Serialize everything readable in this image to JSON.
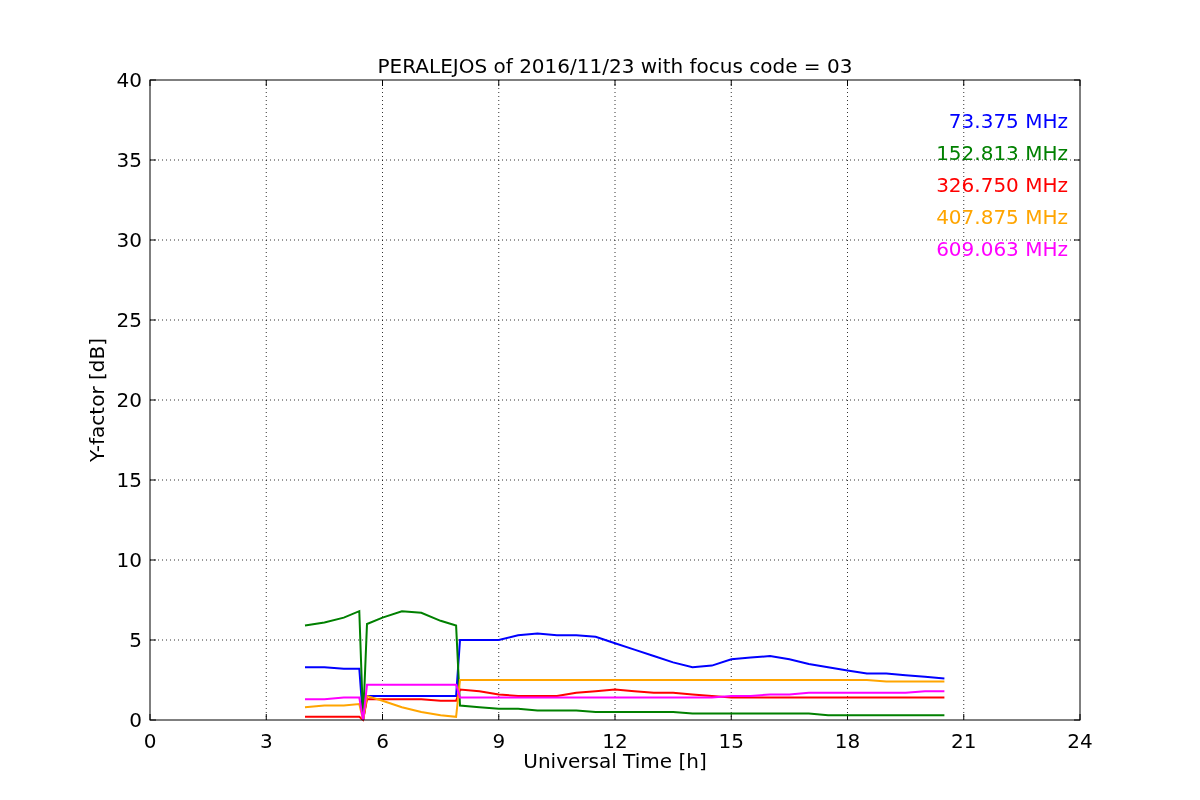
{
  "chart_data": {
    "type": "line",
    "title": "PERALEJOS of 2016/11/23 with focus code = 03",
    "xlabel": "Universal Time [h]",
    "ylabel": "Y-factor [dB]",
    "x": [
      4,
      4.5,
      5,
      5.4,
      5.5,
      5.6,
      6,
      6.5,
      7,
      7.5,
      7.9,
      8,
      8.5,
      9,
      9.5,
      10,
      10.5,
      11,
      11.5,
      12,
      12.5,
      13,
      13.5,
      14,
      14.5,
      15,
      15.5,
      16,
      16.5,
      17,
      17.5,
      18,
      18.5,
      19,
      19.5,
      20,
      20.5
    ],
    "series": [
      {
        "name": "73.375 MHz",
        "color": "#0000ff",
        "values": [
          3.3,
          3.3,
          3.2,
          3.2,
          0,
          1.5,
          1.5,
          1.5,
          1.5,
          1.5,
          1.5,
          5.0,
          5.0,
          5.0,
          5.3,
          5.4,
          5.3,
          5.3,
          5.2,
          4.8,
          4.4,
          4.0,
          3.6,
          3.3,
          3.4,
          3.8,
          3.9,
          4.0,
          3.8,
          3.5,
          3.3,
          3.1,
          2.9,
          2.9,
          2.8,
          2.7,
          2.6
        ]
      },
      {
        "name": "152.813 MHz",
        "color": "#008000",
        "values": [
          5.9,
          6.1,
          6.4,
          6.8,
          0,
          6.0,
          6.4,
          6.8,
          6.7,
          6.2,
          5.9,
          0.9,
          0.8,
          0.7,
          0.7,
          0.6,
          0.6,
          0.6,
          0.5,
          0.5,
          0.5,
          0.5,
          0.5,
          0.4,
          0.4,
          0.4,
          0.4,
          0.4,
          0.4,
          0.4,
          0.3,
          0.3,
          0.3,
          0.3,
          0.3,
          0.3,
          0.3
        ]
      },
      {
        "name": "326.750 MHz",
        "color": "#ff0000",
        "values": [
          0.2,
          0.2,
          0.2,
          0.2,
          0,
          1.3,
          1.3,
          1.3,
          1.3,
          1.2,
          1.2,
          1.9,
          1.8,
          1.6,
          1.5,
          1.5,
          1.5,
          1.7,
          1.8,
          1.9,
          1.8,
          1.7,
          1.7,
          1.6,
          1.5,
          1.4,
          1.4,
          1.4,
          1.4,
          1.4,
          1.4,
          1.4,
          1.4,
          1.4,
          1.4,
          1.4,
          1.4
        ]
      },
      {
        "name": "407.875 MHz",
        "color": "#ffa500",
        "values": [
          0.8,
          0.9,
          0.9,
          1.0,
          0,
          1.5,
          1.2,
          0.8,
          0.5,
          0.3,
          0.2,
          2.5,
          2.5,
          2.5,
          2.5,
          2.5,
          2.5,
          2.5,
          2.5,
          2.5,
          2.5,
          2.5,
          2.5,
          2.5,
          2.5,
          2.5,
          2.5,
          2.5,
          2.5,
          2.5,
          2.5,
          2.5,
          2.5,
          2.4,
          2.4,
          2.4,
          2.4
        ]
      },
      {
        "name": "609.063 MHz",
        "color": "#ff00ff",
        "values": [
          1.3,
          1.3,
          1.4,
          1.4,
          0,
          2.2,
          2.2,
          2.2,
          2.2,
          2.2,
          2.2,
          1.4,
          1.4,
          1.4,
          1.4,
          1.4,
          1.4,
          1.4,
          1.4,
          1.4,
          1.4,
          1.4,
          1.4,
          1.4,
          1.4,
          1.5,
          1.5,
          1.6,
          1.6,
          1.7,
          1.7,
          1.7,
          1.7,
          1.7,
          1.7,
          1.8,
          1.8
        ]
      }
    ],
    "xlim": [
      0,
      24
    ],
    "ylim": [
      0,
      40
    ],
    "xticks": [
      0,
      3,
      6,
      9,
      12,
      15,
      18,
      21,
      24
    ],
    "yticks": [
      0,
      5,
      10,
      15,
      20,
      25,
      30,
      35,
      40
    ],
    "grid": true
  }
}
